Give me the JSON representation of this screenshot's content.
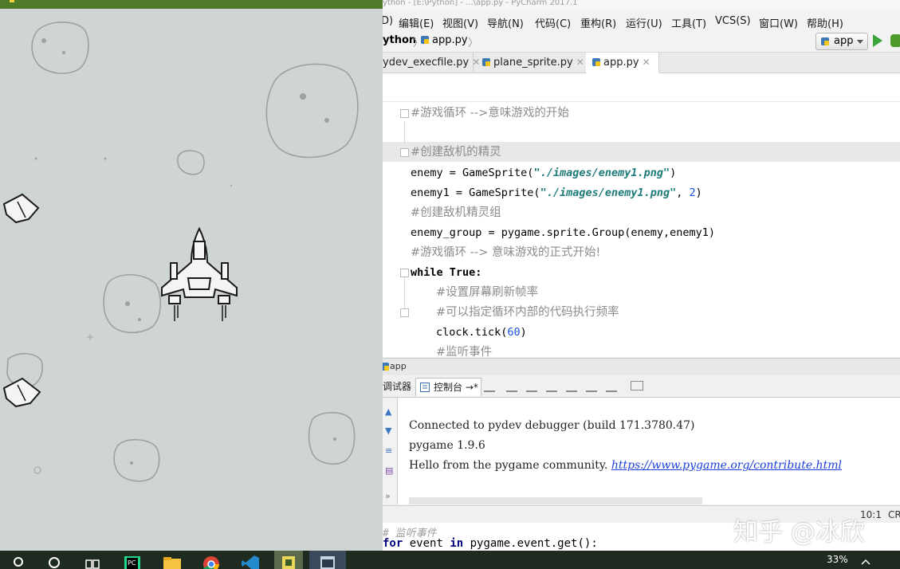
{
  "ide": {
    "title": "ython - [E:\\Python] - ...\\app.py - PyCharm 2017.1",
    "menu": [
      "D)",
      "编辑(E)",
      "视图(V)",
      "导航(N)",
      "代码(C)",
      "重构(R)",
      "运行(U)",
      "工具(T)",
      "VCS(S)",
      "窗口(W)",
      "帮助(H)"
    ],
    "breadcrumb": {
      "project": "ython",
      "file": "app.py"
    },
    "run_config": "app",
    "tabs": [
      {
        "label": "ydev_execfile.py",
        "active": false
      },
      {
        "label": "plane_sprite.py",
        "active": false
      },
      {
        "label": "app.py",
        "active": true
      }
    ],
    "code": {
      "c1": "#游戏循环 -->意味游戏的开始",
      "c2": "#创建敌机的精灵",
      "l3_a": "enemy = GameSprite(",
      "l3_str": "\"./images/enemy1.png\"",
      "l3_b": ")",
      "l4_a": "enemy1 = GameSprite(",
      "l4_str": "\"./images/enemy1.png\"",
      "l4_sep": ", ",
      "l4_num": "2",
      "l4_b": ")",
      "c5": "#创建敌机精灵组",
      "l6": "enemy_group = pygame.sprite.Group(enemy,enemy1)",
      "c7": "#游戏循环 --> 意味游戏的正式开始!",
      "l8_kw": "while True",
      "l8_b": ":",
      "c9": "#设置屏幕刷新帧率",
      "c10": "#可以指定循环内部的代码执行频率",
      "l11_a": "clock.tick(",
      "l11_num": "60",
      "l11_b": ")",
      "c12": "#监听事件"
    },
    "run_panel": {
      "header": "app",
      "tab_debugger": "调试器",
      "tab_console": "控制台 →*"
    },
    "console": {
      "line1": "Connected to pydev debugger (build 171.3780.47)",
      "line2": "pygame 1.9.6",
      "line3_text": "Hello from the pygame community. ",
      "line3_link": "https://www.pygame.org/contribute.html"
    },
    "status": {
      "position": "10:1",
      "line_sep": "CR"
    },
    "bottom_code": {
      "comment": "# 监听事件",
      "kw_for": "for",
      "mid1": " event ",
      "kw_in": "in",
      "rest": " pygame.event.get():"
    }
  },
  "watermark": "知乎 @冰欣",
  "taskbar": {
    "battery": "33%",
    "apps": [
      "search-icon",
      "cortana-icon",
      "task-view-icon",
      "pycharm-icon",
      "file-explorer-icon",
      "chrome-icon",
      "vscode-icon",
      "pygame-app-icon",
      "ide-app-icon"
    ]
  },
  "colors": {
    "game_bg": "#cfd5d4",
    "titlebar": "#4e7a2a",
    "comment": "#8c8c8c",
    "string": "#1f7a7a",
    "number": "#1750eb",
    "link": "#1b3fd9",
    "taskbar": "#1f2a20"
  }
}
